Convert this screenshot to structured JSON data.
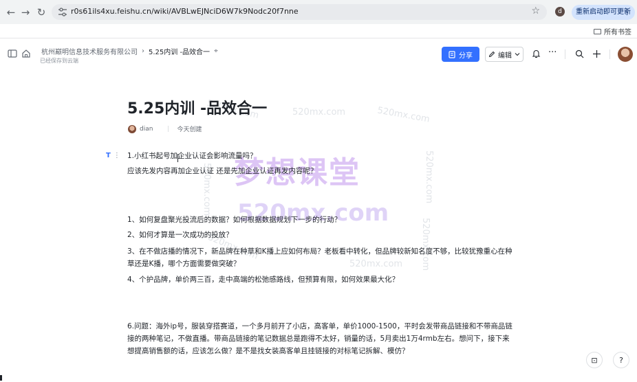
{
  "browser": {
    "url": "r0s61ils4xu.feishu.cn/wiki/AVBLwEJNciD6W7k9Nodc20f7nne",
    "profile_initial": "d",
    "restart_label": "重新启动即可更新",
    "restart_more": "⋮",
    "all_bookmarks": "所有书签",
    "back_glyph": "←",
    "forward_glyph": "→",
    "reload_glyph": "↻",
    "star_glyph": "☆"
  },
  "header": {
    "org": "杭州巅明信息技术服务有限公司",
    "separator": "›",
    "doc_name": "5.25内训 -品效合一",
    "pin_glyph": "⌖",
    "save_status": "已经保存到云端",
    "share_label": "分享",
    "edit_label": "编辑",
    "more_glyph": "···"
  },
  "document": {
    "title": "5.25内训 -品效合一",
    "author": "dian",
    "created": "今天创建",
    "paragraphs": [
      "1.小红书起号加企业认证会影响流量吗？",
      "应该先发内容再加企业认证 还是先加企业认证再发内容呢？",
      "1、如何复盘聚光投流后的数据？如何根据数据规划下一步的行动？",
      "2、如何才算是一次成功的投放？",
      "3、在不做店播的情况下，新品牌在种草和K播上应如何布局？老板看中转化，但品牌较新知名度不够，比较犹豫重心在种草还是K播，哪个方面需要做突破？",
      "4、个护品牌，单价两三百，走中高端的松弛感路线，但预算有限，如何效果最大化？",
      "6.问题：海外ip号，服装穿搭赛道，一个多月前开了小店，高客单，单价1000-1500，平时会发带商品链接和不带商品链接的两种笔记，不做直播。带商品链接的笔记数据总是跑得不太好，销量的话，5月卖出1万4rmb左右。想问下，接下来想提高销售额的话，应该怎么做？是不是找女装高客单且挂链接的对标笔记拆解、模仿？"
    ]
  },
  "watermarks": {
    "small": "520mx.com",
    "big_title": "梦想课堂",
    "big_url": "520mx.com"
  },
  "float": {
    "help_glyph": "?",
    "doc_glyph": "⊡"
  }
}
